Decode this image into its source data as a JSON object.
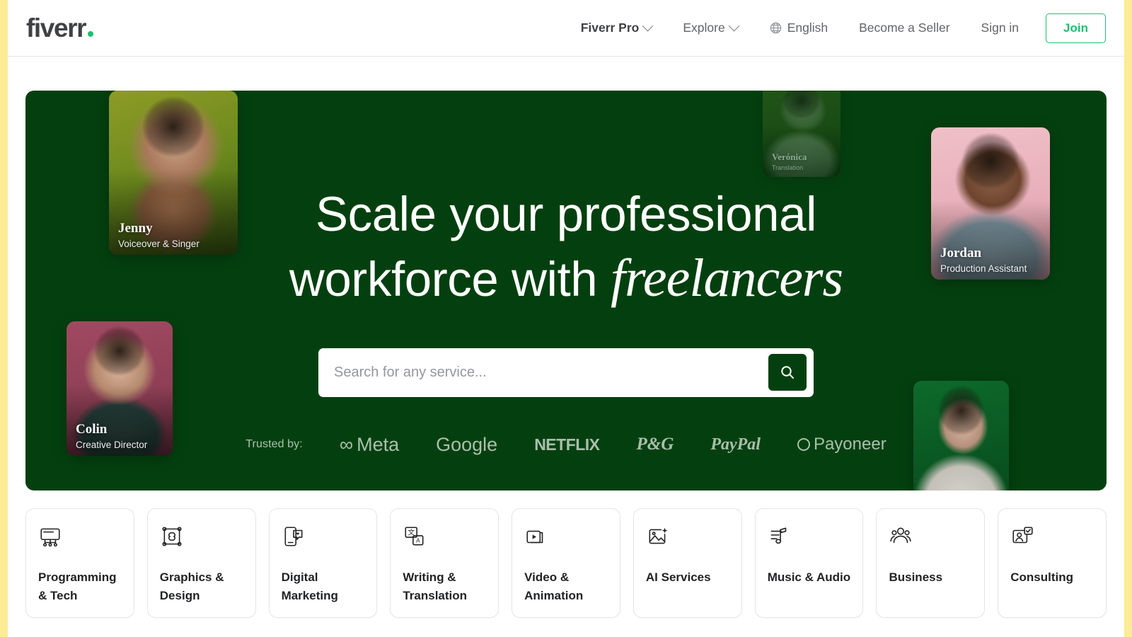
{
  "brand": {
    "logo_text": "fiverr",
    "logo_dot": ".",
    "accent_green": "#1dbf73",
    "hero_green": "#04400f",
    "edge_strip_yellow": "#fdeb95"
  },
  "header": {
    "nav": [
      {
        "label": "Fiverr Pro",
        "has_chevron": true,
        "strong": true
      },
      {
        "label": "Explore",
        "has_chevron": true,
        "strong": false
      },
      {
        "label": "English",
        "icon": "globe-icon",
        "strong": false
      },
      {
        "label": "Become a Seller",
        "strong": false
      },
      {
        "label": "Sign in",
        "strong": false
      }
    ],
    "join_label": "Join"
  },
  "hero": {
    "title_line1": "Scale your professional",
    "title_line2_prefix": "workforce with ",
    "title_line2_italic": "freelancers",
    "search": {
      "placeholder": "Search for any service...",
      "value": "",
      "button_icon": "search-icon"
    },
    "trusted": {
      "label": "Trusted by:",
      "brands": [
        {
          "name": "Meta",
          "glyph": "∞"
        },
        {
          "name": "Google",
          "glyph": ""
        },
        {
          "name": "NETFLIX",
          "glyph": ""
        },
        {
          "name": "P&G",
          "glyph": ""
        },
        {
          "name": "PayPal",
          "glyph": ""
        },
        {
          "name": "Payoneer",
          "glyph": "ring"
        }
      ]
    },
    "freelancer_cards": [
      {
        "id": "jenny",
        "name": "Jenny",
        "role": "Voiceover & Singer",
        "bg": "olive"
      },
      {
        "id": "colin",
        "name": "Colin",
        "role": "Creative Director",
        "bg": "wine"
      },
      {
        "id": "veronica",
        "name": "Verónica",
        "role": "Translation",
        "bg": "ghost"
      },
      {
        "id": "jordan",
        "name": "Jordan",
        "role": "Production Assistant",
        "bg": "pink"
      },
      {
        "id": "nadia",
        "name": "",
        "role": "",
        "bg": "green"
      }
    ]
  },
  "categories": [
    {
      "label": "Programming\n& Tech",
      "icon": "monitor-code-icon"
    },
    {
      "label": "Graphics &\nDesign",
      "icon": "design-node-icon"
    },
    {
      "label": "Digital\nMarketing",
      "icon": "phone-heart-icon"
    },
    {
      "label": "Writing &\nTranslation",
      "icon": "translate-icon"
    },
    {
      "label": "Video &\nAnimation",
      "icon": "video-play-icon"
    },
    {
      "label": "AI Services",
      "icon": "image-sparkle-icon"
    },
    {
      "label": "Music & Audio",
      "icon": "music-note-icon"
    },
    {
      "label": "Business",
      "icon": "people-group-icon"
    },
    {
      "label": "Consulting",
      "icon": "person-check-icon"
    }
  ]
}
